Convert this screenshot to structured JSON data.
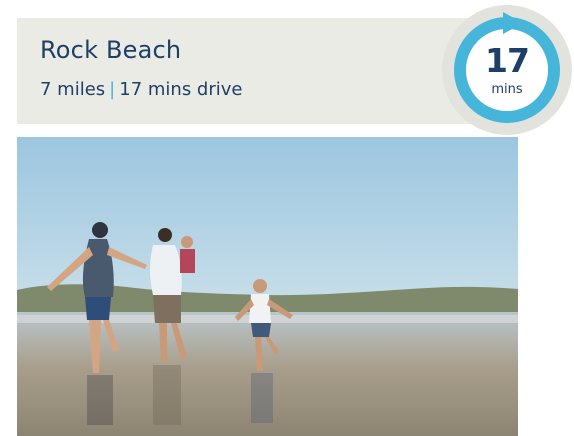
{
  "destination": {
    "name": "Rock Beach",
    "distance": "7 miles",
    "separator": "|",
    "drive_time": "17 mins drive"
  },
  "badge": {
    "number": "17",
    "unit": "mins",
    "icon": "circular-arrow-icon",
    "colors": {
      "ring": "#45b6da",
      "outer": "#e3e3dd",
      "inner": "#ffffff",
      "text": "#1e3f66"
    }
  },
  "photo": {
    "icon": "beach-family-photo"
  },
  "colors": {
    "header_background": "#ebebe6",
    "title_text": "#1e3f66",
    "accent": "#45b6da"
  }
}
